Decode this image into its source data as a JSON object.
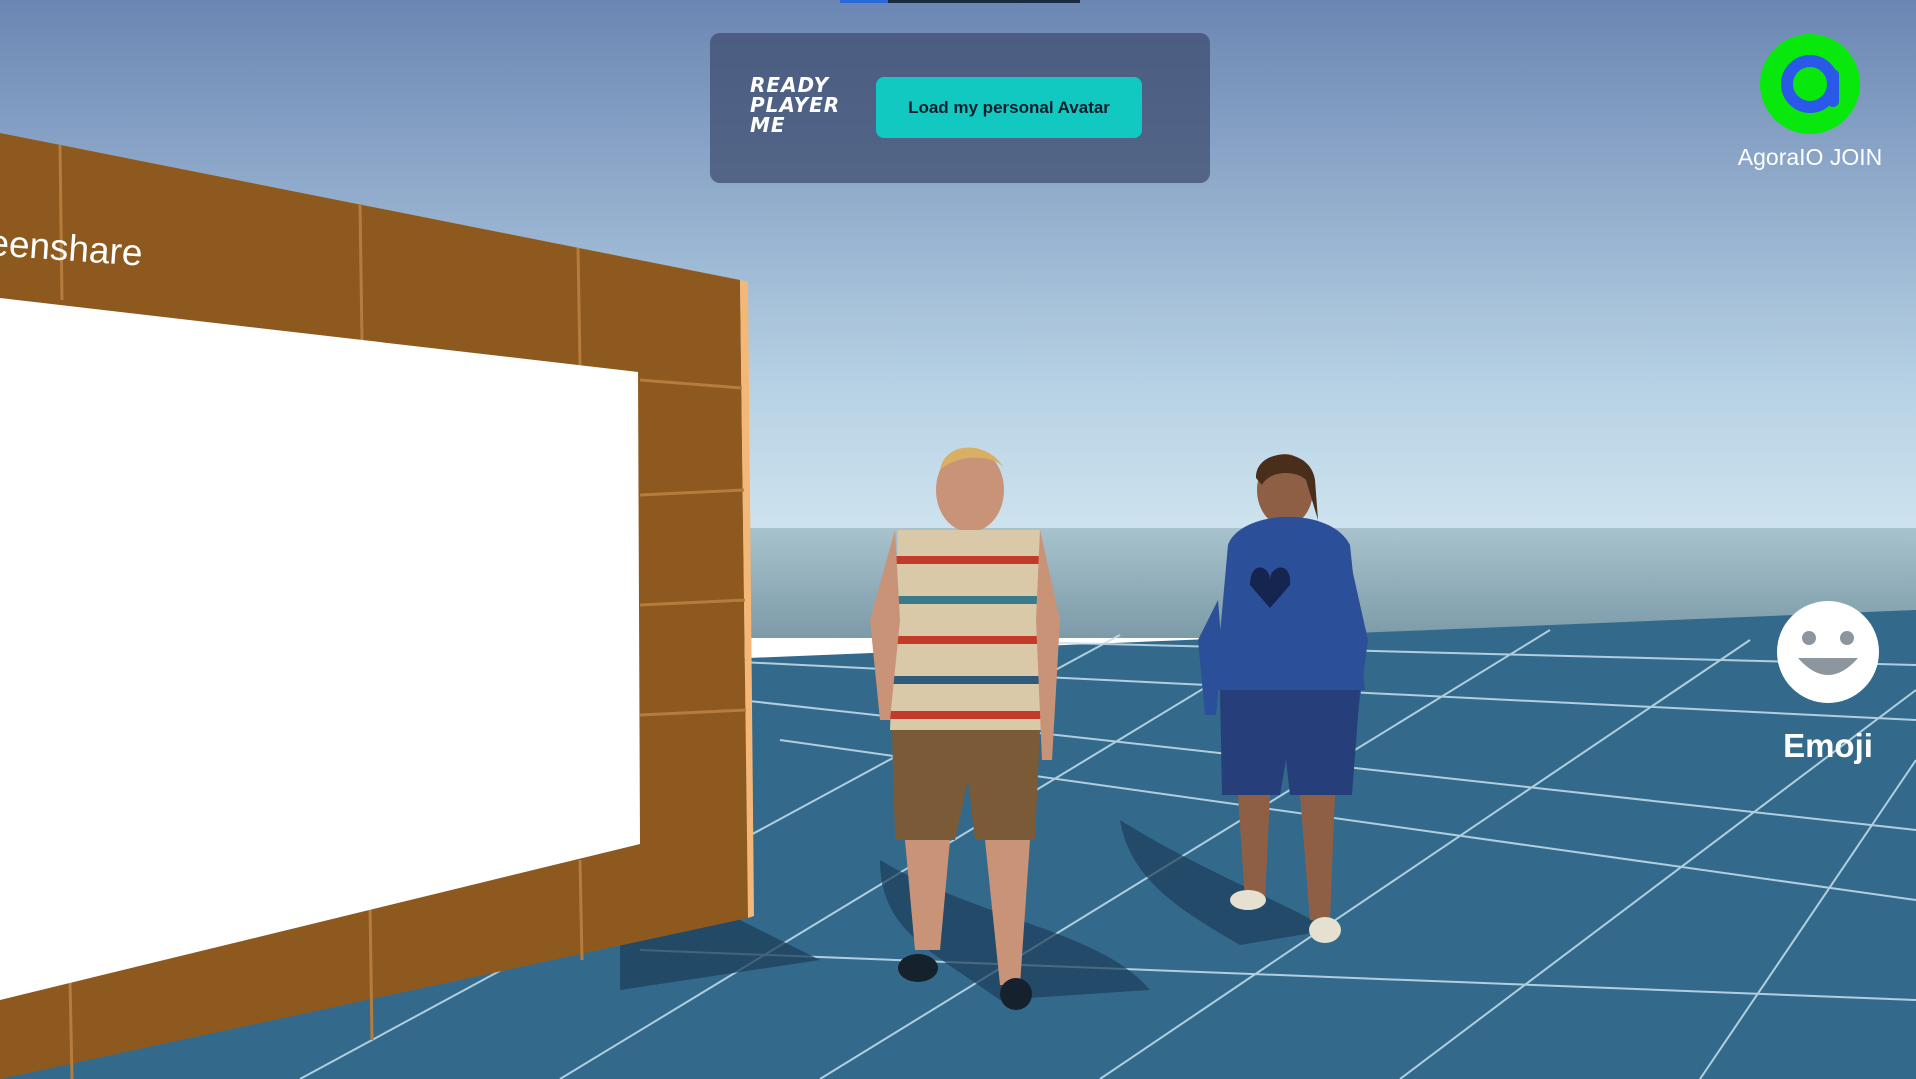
{
  "hud": {
    "brand_logo_lines": [
      "READY",
      "PLAYER",
      "ME"
    ],
    "load_avatar_label": "Load my personal Avatar",
    "agora_join_label": "AgoraIO JOIN",
    "emoji_label": "Emoji"
  },
  "scene": {
    "wall_sign_text": "eenshare"
  },
  "colors": {
    "accent_button": "#12c9c2",
    "agora_green": "#08e80d",
    "floor_tile": "#336a8c",
    "wall_wood": "#8e591e"
  }
}
